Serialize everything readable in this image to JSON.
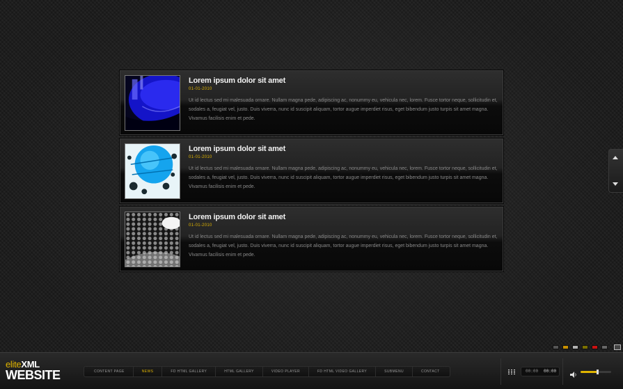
{
  "news": [
    {
      "title": "Lorem ipsum dolor sit amet",
      "date": "01-01-2010",
      "body": "Ut id lectus sed mi malesuada ornare. Nullam magna pede, adipiscing ac, nonummy eu, vehicula nec, lorem. Fusce tortor neque, sollicitudin et, sodales a, feugiat vel, justo. Duis viverra, nunc id suscipit aliquam, tortor augue imperdiet risus, eget bibendum justo turpis sit amet magna. Vivamus facilisis enim et pede."
    },
    {
      "title": "Lorem ipsum dolor sit amet",
      "date": "01-01-2010",
      "body": "Ut id lectus sed mi malesuada ornare. Nullam magna pede, adipiscing ac, nonummy eu, vehicula nec, lorem. Fusce tortor neque, sollicitudin et, sodales a, feugiat vel, justo. Duis viverra, nunc id suscipit aliquam, tortor augue imperdiet risus, eget bibendum justo turpis sit amet magna. Vivamus facilisis enim et pede."
    },
    {
      "title": "Lorem ipsum dolor sit amet",
      "date": "01-01-2010",
      "body": "Ut id lectus sed mi malesuada ornare. Nullam magna pede, adipiscing ac, nonummy eu, vehicula nec, lorem. Fusce tortor neque, sollicitudin et, sodales a, feugiat vel, justo. Duis viverra, nunc id suscipit aliquam, tortor augue imperdiet risus, eget bibendum justo turpis sit amet magna. Vivamus facilisis enim et pede."
    }
  ],
  "logo": {
    "prefix": "elite",
    "suffix": "XML",
    "bottom": "WEBSITE"
  },
  "nav": {
    "items": [
      "CONTENT PAGE",
      "NEWS",
      "FD HTML GALLERY",
      "HTML GALLERY",
      "VIDEO PLAYER",
      "FD HTML VIDEO GALLERY",
      "SUBMENU",
      "CONTACT"
    ],
    "active_index": 1
  },
  "player": {
    "time_elapsed": "00:00",
    "time_total": "00:00",
    "volume": 0.55
  },
  "swatch_colors": [
    "#555555",
    "#c89000",
    "#b2b2b2",
    "#7a7000",
    "#cc1111",
    "#666666"
  ],
  "colors": {
    "accent": "#e0b400"
  },
  "icons": {
    "scroll_up": "chevron-up-icon",
    "scroll_down": "chevron-down-icon",
    "grid": "grid-icon",
    "volume": "speaker-icon",
    "fullscreen": "fullscreen-icon"
  }
}
